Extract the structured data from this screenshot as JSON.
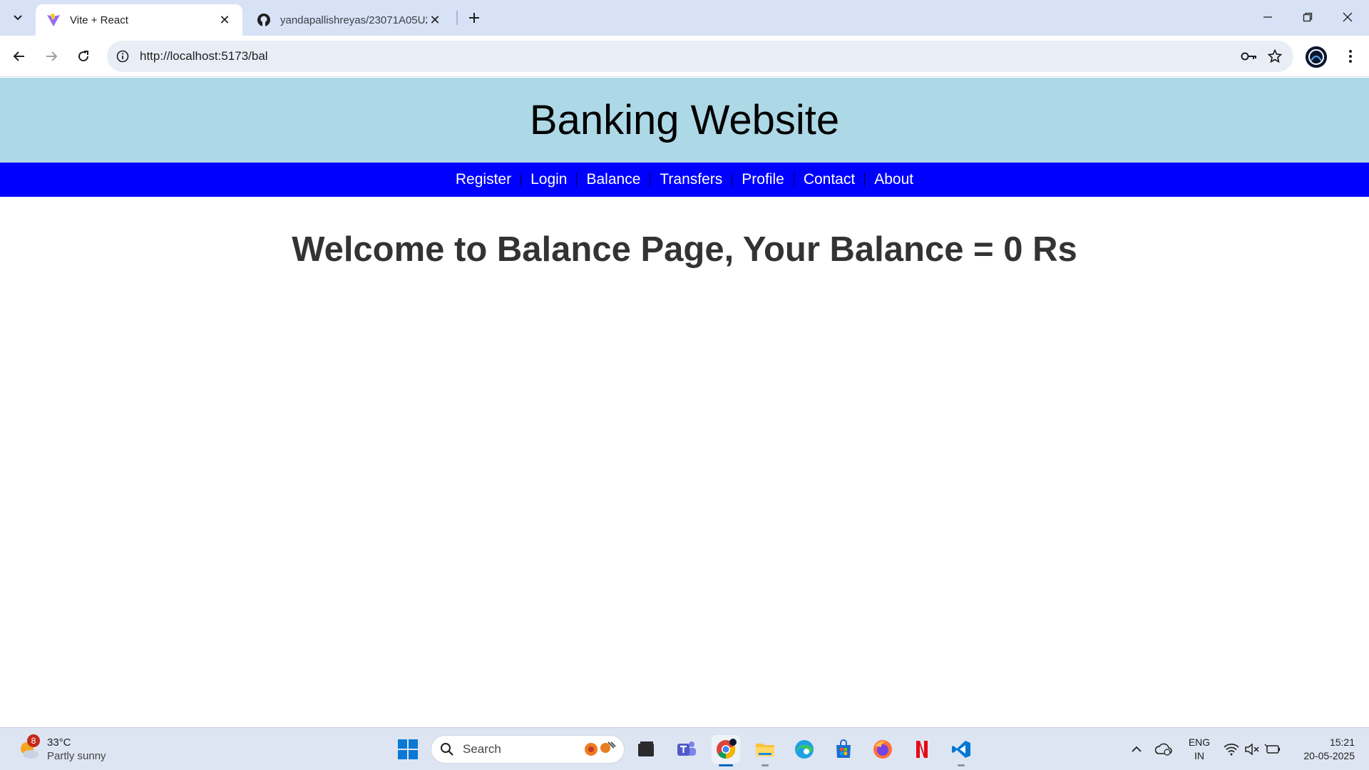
{
  "browser": {
    "tabs": [
      {
        "title": "Vite + React",
        "active": true,
        "icon": "vite-icon"
      },
      {
        "title": "yandapallishreyas/23071A05U2",
        "active": false,
        "icon": "github-icon"
      }
    ],
    "url": "http://localhost:5173/bal"
  },
  "site": {
    "title": "Banking Website",
    "nav": [
      "Register",
      "Login",
      "Balance",
      "Transfers",
      "Profile",
      "Contact",
      "About"
    ],
    "welcome": "Welcome to Balance Page, Your Balance = 0 Rs",
    "colors": {
      "header_bg": "#add8e6",
      "nav_bg": "#0000ff",
      "nav_text": "#ffffff",
      "heading": "#333333"
    }
  },
  "taskbar": {
    "weather": {
      "temp": "33°C",
      "condition": "Partly sunny",
      "badge": "8"
    },
    "search_placeholder": "Search",
    "language": {
      "line1": "ENG",
      "line2": "IN"
    },
    "time": "15:21",
    "date": "20-05-2025"
  }
}
